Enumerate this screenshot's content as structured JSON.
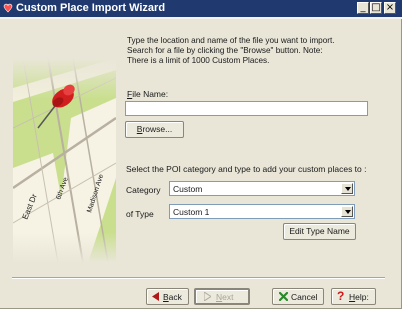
{
  "window": {
    "title": "Custom Place Import Wizard",
    "minimize_glyph": "_",
    "maximize_glyph": "□",
    "close_glyph": "×"
  },
  "map": {
    "street_labels": [
      "East Dr",
      "6th Ave",
      "Madison Ave"
    ]
  },
  "instructions": "Type the location and name of the file you want to import.\nSearch for a file by clicking the \"Browse\" button. Note:\nThere is a limit of 1000 Custom Places.",
  "file_name": {
    "label_underlined": "F",
    "label_rest": "ile Name:",
    "value": ""
  },
  "browse_button": {
    "label_underlined": "B",
    "label_rest": "rowse..."
  },
  "poi_prompt": "Select the POI category and type to add your custom places to :",
  "category": {
    "label": "Category",
    "selected": "Custom"
  },
  "type": {
    "label": "of Type",
    "selected": "Custom 1"
  },
  "edit_type_button": "Edit Type Name",
  "nav": {
    "back": {
      "underlined": "B",
      "rest": "ack"
    },
    "next": {
      "underlined": "N",
      "rest": "ext"
    },
    "cancel": "Cancel",
    "help": {
      "underlined": "H",
      "rest": "elp:"
    }
  },
  "colors": {
    "titlebar": "#203a6f",
    "map_green": "#c8de8c",
    "pin_red": "#d11f1f",
    "back_icon": "#b01818",
    "cancel_icon": "#2a8a2a",
    "help_icon": "#d01a1a"
  }
}
